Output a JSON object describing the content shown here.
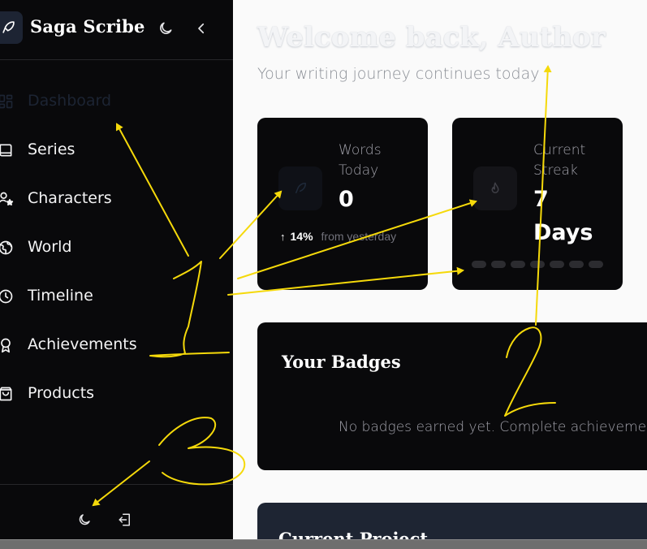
{
  "app": {
    "name": "Saga Scribe"
  },
  "sidebar": {
    "items": [
      {
        "label": "Dashboard",
        "icon": "dashboard-grid-icon",
        "active": true
      },
      {
        "label": "Series",
        "icon": "book-icon"
      },
      {
        "label": "Characters",
        "icon": "characters-icon"
      },
      {
        "label": "World",
        "icon": "globe-icon"
      },
      {
        "label": "Timeline",
        "icon": "clock-icon"
      },
      {
        "label": "Achievements",
        "icon": "award-icon"
      },
      {
        "label": "Products",
        "icon": "shopping-bag-icon"
      }
    ]
  },
  "header": {
    "title": "Welcome back, Author",
    "subtitle": "Your writing journey continues today"
  },
  "stats": {
    "words": {
      "label": "Words Today",
      "value": "0",
      "trend_pct": "14%",
      "trend_text": "from yesterday"
    },
    "streak": {
      "label": "Current Streak",
      "value": "7 Days",
      "dots": 7
    }
  },
  "badges": {
    "title": "Your Badges",
    "empty_text": "No badges earned yet. Complete achievements to"
  },
  "project": {
    "title": "Current Project"
  },
  "annotations": {
    "labels": [
      "1",
      "2",
      "3"
    ],
    "color": "#f5d90a"
  },
  "colors": {
    "sidebar_bg": "#09090b",
    "main_bg": "#fafafa",
    "card_bg": "#09090b",
    "project_card_bg": "#1e2533",
    "active_nav_text": "#1c2433"
  }
}
